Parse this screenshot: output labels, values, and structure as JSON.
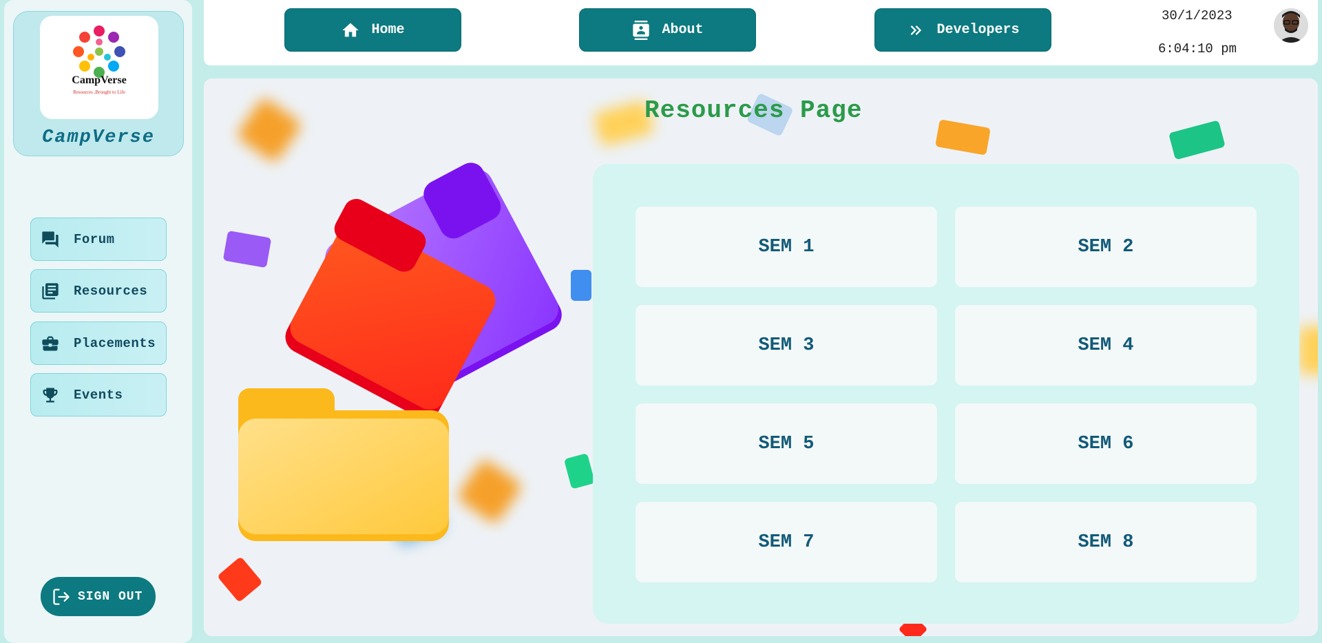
{
  "brand": {
    "name": "CampVerse",
    "logo_text": "CampVerse",
    "logo_tagline": "Resources ,Brought to Life"
  },
  "sidebar": {
    "items": [
      {
        "label": "Forum",
        "icon": "forum-icon"
      },
      {
        "label": "Resources",
        "icon": "library-books-icon"
      },
      {
        "label": "Placements",
        "icon": "briefcase-icon"
      },
      {
        "label": "Events",
        "icon": "trophy-icon"
      }
    ],
    "signout_label": "SIGN OUT"
  },
  "topbar": {
    "nav": [
      {
        "label": "Home",
        "icon": "home-icon"
      },
      {
        "label": "About",
        "icon": "contact-card-icon"
      },
      {
        "label": "Developers",
        "icon": "double-chevron-right-icon"
      }
    ],
    "date": "30/1/2023",
    "time": "6:04:10 pm"
  },
  "main": {
    "title": "Resources Page",
    "semesters": [
      "SEM 1",
      "SEM 2",
      "SEM 3",
      "SEM 4",
      "SEM 5",
      "SEM 6",
      "SEM 7",
      "SEM 8"
    ]
  },
  "colors": {
    "accent": "#0c7a80",
    "title_green": "#2b9a4a",
    "sem_text": "#125a78",
    "panel": "#d4f5f2"
  }
}
